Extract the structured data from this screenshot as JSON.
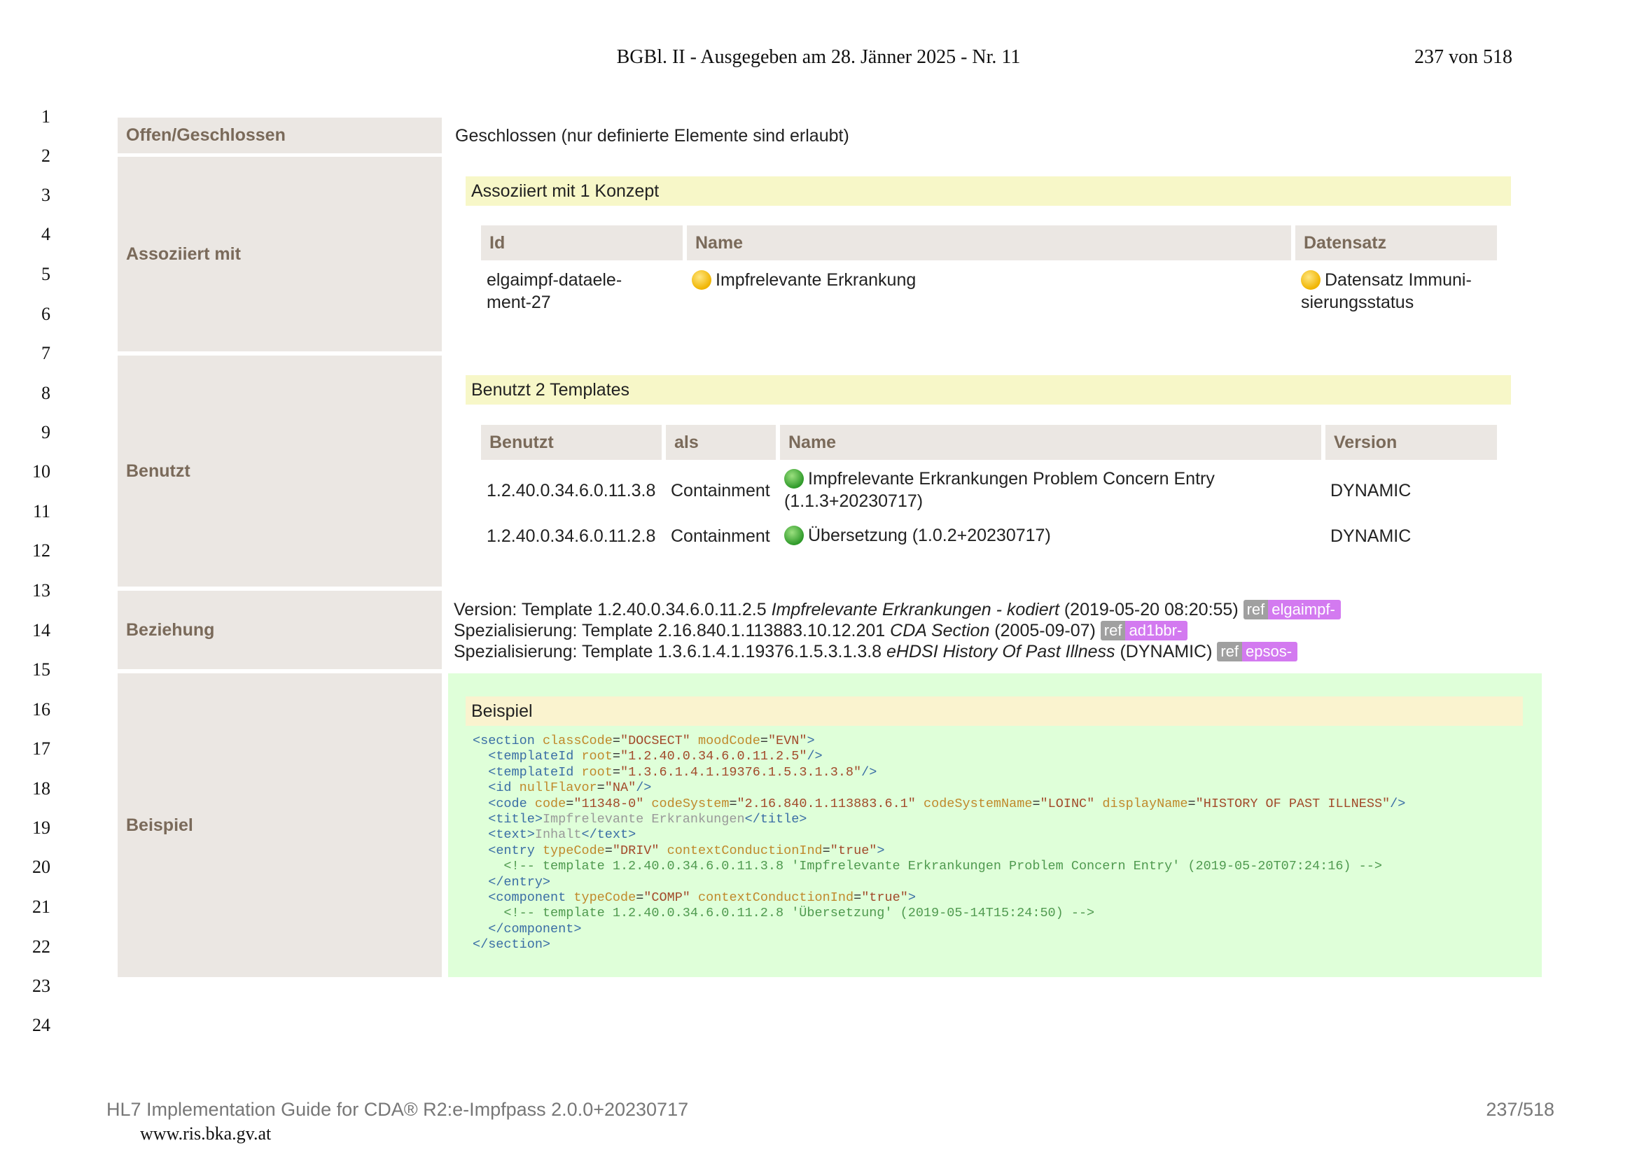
{
  "header": {
    "title": "BGBl. II - Ausgegeben am 28. Jänner 2025 - Nr. 11",
    "page": "237 von 518"
  },
  "line_numbers": [
    "1",
    "2",
    "3",
    "4",
    "5",
    "6",
    "7",
    "8",
    "9",
    "10",
    "11",
    "12",
    "13",
    "14",
    "15",
    "16",
    "17",
    "18",
    "19",
    "20",
    "21",
    "22",
    "23",
    "24"
  ],
  "rows": {
    "offen": {
      "label": "Offen/Geschlossen",
      "value": "Geschlossen (nur definierte Elemente sind erlaubt)"
    },
    "assoziiert": {
      "label": "Assoziiert mit",
      "bar": "Assoziiert mit 1 Konzept",
      "headers": [
        "Id",
        "Name",
        "Datensatz"
      ],
      "id_line1": "elgaimpf-dataele-",
      "id_line2": "ment-27",
      "name": "Impfrelevante Erkrankung",
      "datensatz_line1": "Datensatz Immuni-",
      "datensatz_line2": "sierungsstatus"
    },
    "benutzt": {
      "label": "Benutzt",
      "bar": "Benutzt 2 Templates",
      "headers": [
        "Benutzt",
        "als",
        "Name",
        "Version"
      ],
      "items": [
        {
          "id": "1.2.40.0.34.6.0.11.3.8",
          "als": "Containment",
          "name_line1": "Impfrelevante Erkrankungen Problem Concern Entry",
          "name_line2": "(1.1.3+20230717)",
          "version": "DYNAMIC"
        },
        {
          "id": "1.2.40.0.34.6.0.11.2.8",
          "als": "Containment",
          "name_line1": "Übersetzung (1.0.2+20230717)",
          "version": "DYNAMIC"
        }
      ]
    },
    "beziehung": {
      "label": "Beziehung",
      "lines": [
        {
          "prefix": "Version: Template 1.2.40.0.34.6.0.11.2.5 ",
          "italic": "Impfrelevante Erkrankungen - kodiert",
          "suffix": " (2019‑05‑20 08:20:55)",
          "ref": "ref",
          "ref_target": "elgaimpf-"
        },
        {
          "prefix": "Spezialisierung: Template 2.16.840.1.113883.10.12.201 ",
          "italic": "CDA Section",
          "suffix": " (2005‑09‑07)",
          "ref": "ref",
          "ref_target": "ad1bbr-"
        },
        {
          "prefix": "Spezialisierung: Template 1.3.6.1.4.1.19376.1.5.3.1.3.8 ",
          "italic": "eHDSI History Of Past Illness",
          "suffix": " (DYNAMIC)",
          "ref": "ref",
          "ref_target": "epsos-"
        }
      ]
    },
    "beispiel": {
      "label": "Beispiel",
      "bar": "Beispiel",
      "code": {
        "section_open": "<section",
        "classCode": "classCode",
        "classCode_val": "\"DOCSECT\"",
        "moodCode": "moodCode",
        "moodCode_val": "\"EVN\"",
        "t1": "<templateId",
        "root": "root",
        "t1_val": "\"1.2.40.0.34.6.0.11.2.5\"",
        "t2_val": "\"1.3.6.1.4.1.19376.1.5.3.1.3.8\"",
        "id": "<id",
        "nullFlavor": "nullFlavor",
        "nf_val": "\"NA\"",
        "code": "<code",
        "code_attr": "code",
        "code_val": "\"11348-0\"",
        "codeSystem": "codeSystem",
        "cs_val": "\"2.16.840.1.113883.6.1\"",
        "codeSystemName": "codeSystemName",
        "csn_val": "\"LOINC\"",
        "displayName": "displayName",
        "dn_val": "\"HISTORY OF PAST ILLNESS\"",
        "title_open": "<title>",
        "title_text": "Impfrelevante Erkrankungen",
        "title_close": "</title>",
        "text_open": "<text>",
        "text_text": "Inhalt",
        "text_close": "</text>",
        "entry": "<entry",
        "typeCode": "typeCode",
        "entry_tc": "\"DRIV\"",
        "ccInd": "contextConductionInd",
        "true_val": "\"true\"",
        "comment1": "<!-- template 1.2.40.0.34.6.0.11.3.8 'Impfrelevante Erkrankungen Problem Concern Entry' (2019-05-20T07:24:16) -->",
        "entry_close": "</entry>",
        "component": "<component",
        "comp_tc": "\"COMP\"",
        "comment2": "<!-- template 1.2.40.0.34.6.0.11.2.8 'Übersetzung' (2019-05-14T15:24:50) -->",
        "component_close": "</component>",
        "section_close": "</section>",
        "self_close": "/>",
        "gt": ">"
      }
    }
  },
  "footer": {
    "left": "HL7 Implementation Guide for CDA® R2:e-Impfpass 2.0.0+20230717",
    "right": "237/518",
    "url": "www.ris.bka.gv.at"
  },
  "colors": {
    "label_bg": "#ebe7e3",
    "label_text": "#7a6a5a",
    "bar_yellow": "#f7f7c8",
    "example_bg": "#dfffd9",
    "ref_gray": "#a0a0a0",
    "ref_purple": "#d37af0"
  }
}
